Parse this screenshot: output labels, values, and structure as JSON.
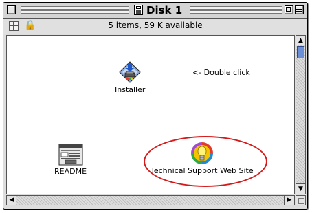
{
  "window": {
    "title": "Disk 1"
  },
  "header": {
    "status": "5 items, 59 K available",
    "lock_glyph": "🔒"
  },
  "icons": [
    {
      "label": "Installer",
      "icon": "installer-icon"
    },
    {
      "label": "README",
      "icon": "document-icon"
    },
    {
      "label": "Technical Support Web Site",
      "icon": "lightbulb-icon"
    }
  ],
  "annotation": "<- Double click",
  "colors": {
    "highlight": "#d61a1a",
    "scroll_thumb": "#6b8fd6"
  },
  "scroll": {
    "up_glyph": "▲",
    "down_glyph": "▼",
    "left_glyph": "◀",
    "right_glyph": "▶"
  }
}
